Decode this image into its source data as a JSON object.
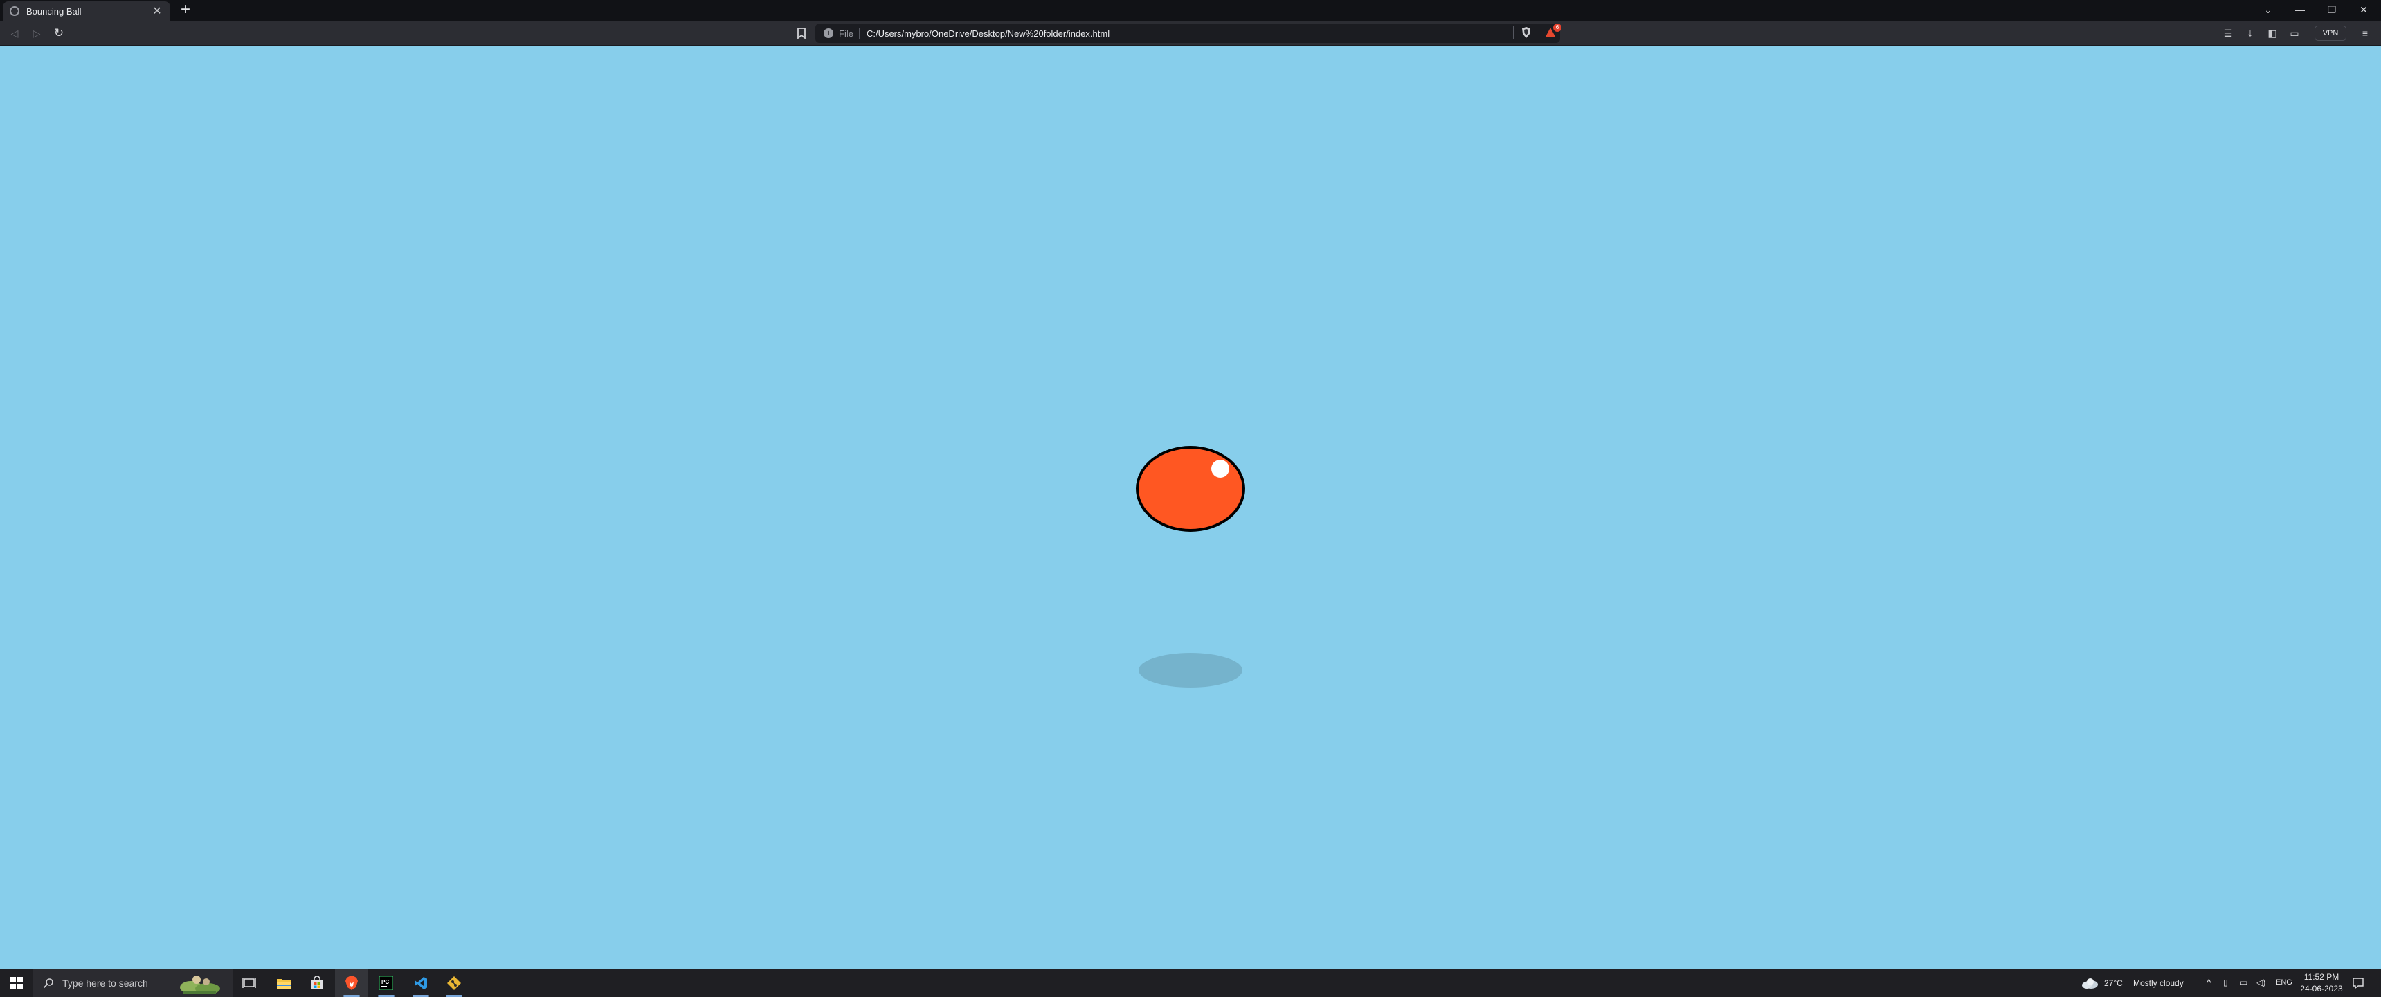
{
  "browser": {
    "tab": {
      "title": "Bouncing Ball"
    },
    "address": {
      "scheme": "File",
      "url": "C:/Users/mybro/OneDrive/Desktop/New%20folder/index.html"
    },
    "rewards_badge": "6",
    "vpn_label": "VPN"
  },
  "page": {
    "background_color": "#87ceeb",
    "ball_color": "#ff5722",
    "ball_outline_color": "#000000",
    "highlight_color": "#ffffff"
  },
  "taskbar": {
    "search_placeholder": "Type here to search",
    "weather": {
      "temperature": "27°C",
      "condition": "Mostly cloudy"
    },
    "language": "ENG",
    "time": "11:52 PM",
    "date": "24-06-2023"
  }
}
